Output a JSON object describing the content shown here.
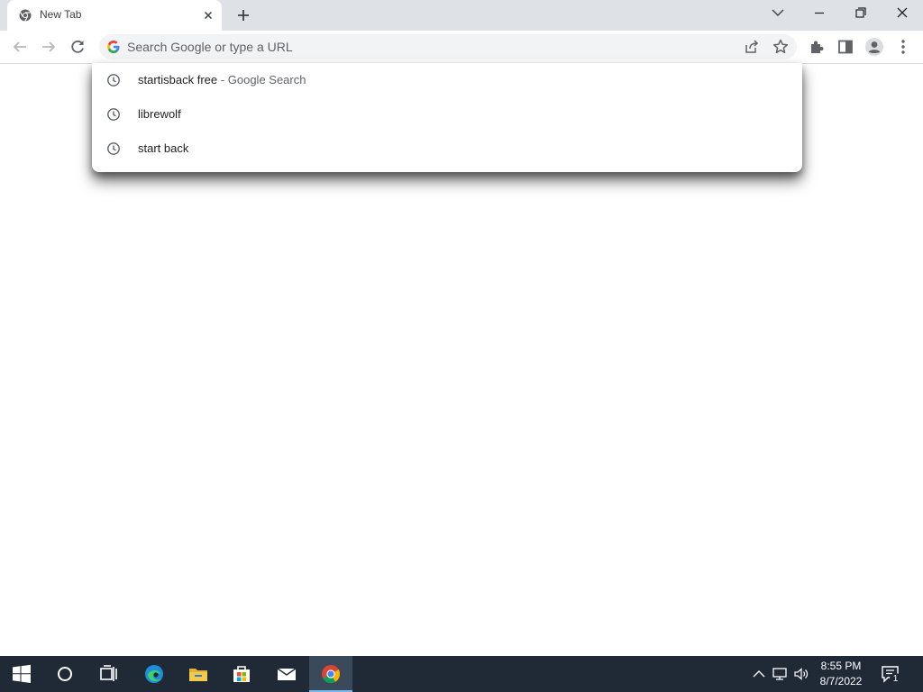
{
  "browser": {
    "tab": {
      "title": "New Tab",
      "favicon": "chrome-icon"
    },
    "new_tab_icon": "plus-icon",
    "window_controls": [
      "chevron-down-icon",
      "minimize-icon",
      "restore-icon",
      "close-icon"
    ],
    "nav": [
      "back-arrow-icon",
      "forward-arrow-icon",
      "reload-icon"
    ],
    "omnibox": {
      "placeholder": "Search Google or type a URL",
      "value": "",
      "icons": [
        "google-g-icon",
        "share-icon",
        "star-icon"
      ]
    },
    "toolbar_icons": [
      "extensions-puzzle-icon",
      "side-panel-icon",
      "profile-avatar-icon",
      "more-vert-icon"
    ]
  },
  "suggestions": [
    {
      "text": "startisback free",
      "separator": "-",
      "description": "Google Search",
      "icon": "history-clock-icon"
    },
    {
      "text": "librewolf",
      "icon": "history-clock-icon"
    },
    {
      "text": "start back",
      "icon": "history-clock-icon"
    }
  ],
  "taskbar": {
    "apps": [
      "windows-start-icon",
      "cortana-circle-icon",
      "task-view-icon",
      "edge-icon",
      "file-explorer-icon",
      "store-icon",
      "mail-icon",
      "chrome-icon"
    ],
    "active_app": "chrome-icon",
    "tray_icons": [
      "chevron-up-icon",
      "network-icon",
      "speaker-icon"
    ],
    "time": "8:55 PM",
    "date": "8/7/2022",
    "notification_count": "1"
  },
  "colors": {
    "tabstrip": "#dee1e6",
    "omnibox": "#f1f3f4",
    "taskbar": "#1f2a36",
    "accent": "#1a73e8"
  }
}
